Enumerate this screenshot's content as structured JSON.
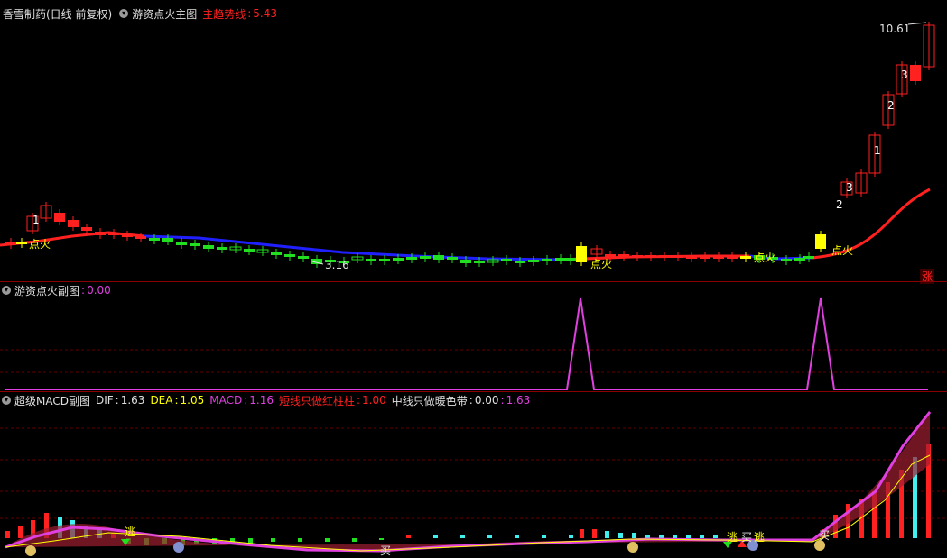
{
  "main": {
    "stock_title": "香雪制药(日线 前复权)",
    "indicator_name": "游资点火主图",
    "trend_label": "主趋势线",
    "trend_value": "5.43",
    "high_label": "10.61",
    "low_label": "3.16",
    "ignite_label": "点火",
    "rise_badge": "涨",
    "count_labels": [
      "1",
      "3",
      "2",
      "1",
      "3",
      "2"
    ]
  },
  "sub1": {
    "name": "游资点火副图",
    "value": "0.00"
  },
  "sub2": {
    "name": "超级MACD副图",
    "dif_label": "DIF",
    "dif_value": "1.63",
    "dea_label": "DEA",
    "dea_value": "1.05",
    "macd_label": "MACD",
    "macd_value": "1.16",
    "short_label": "短线只做红柱柱",
    "short_value": "1.00",
    "mid_label": "中线只做暖色带",
    "mid_value": "0.00",
    "mid_value2": "1.63",
    "escape_label": "逃",
    "buy_label": "买"
  },
  "colors": {
    "bg": "#000000",
    "up": "#ff2020",
    "down": "#20e020",
    "trend_up": "#ff2020",
    "trend_down": "#2020ff",
    "magenta": "#e040e0",
    "yellow": "#ffff00",
    "cyan": "#40f0f0",
    "separator": "#8a0000"
  }
}
